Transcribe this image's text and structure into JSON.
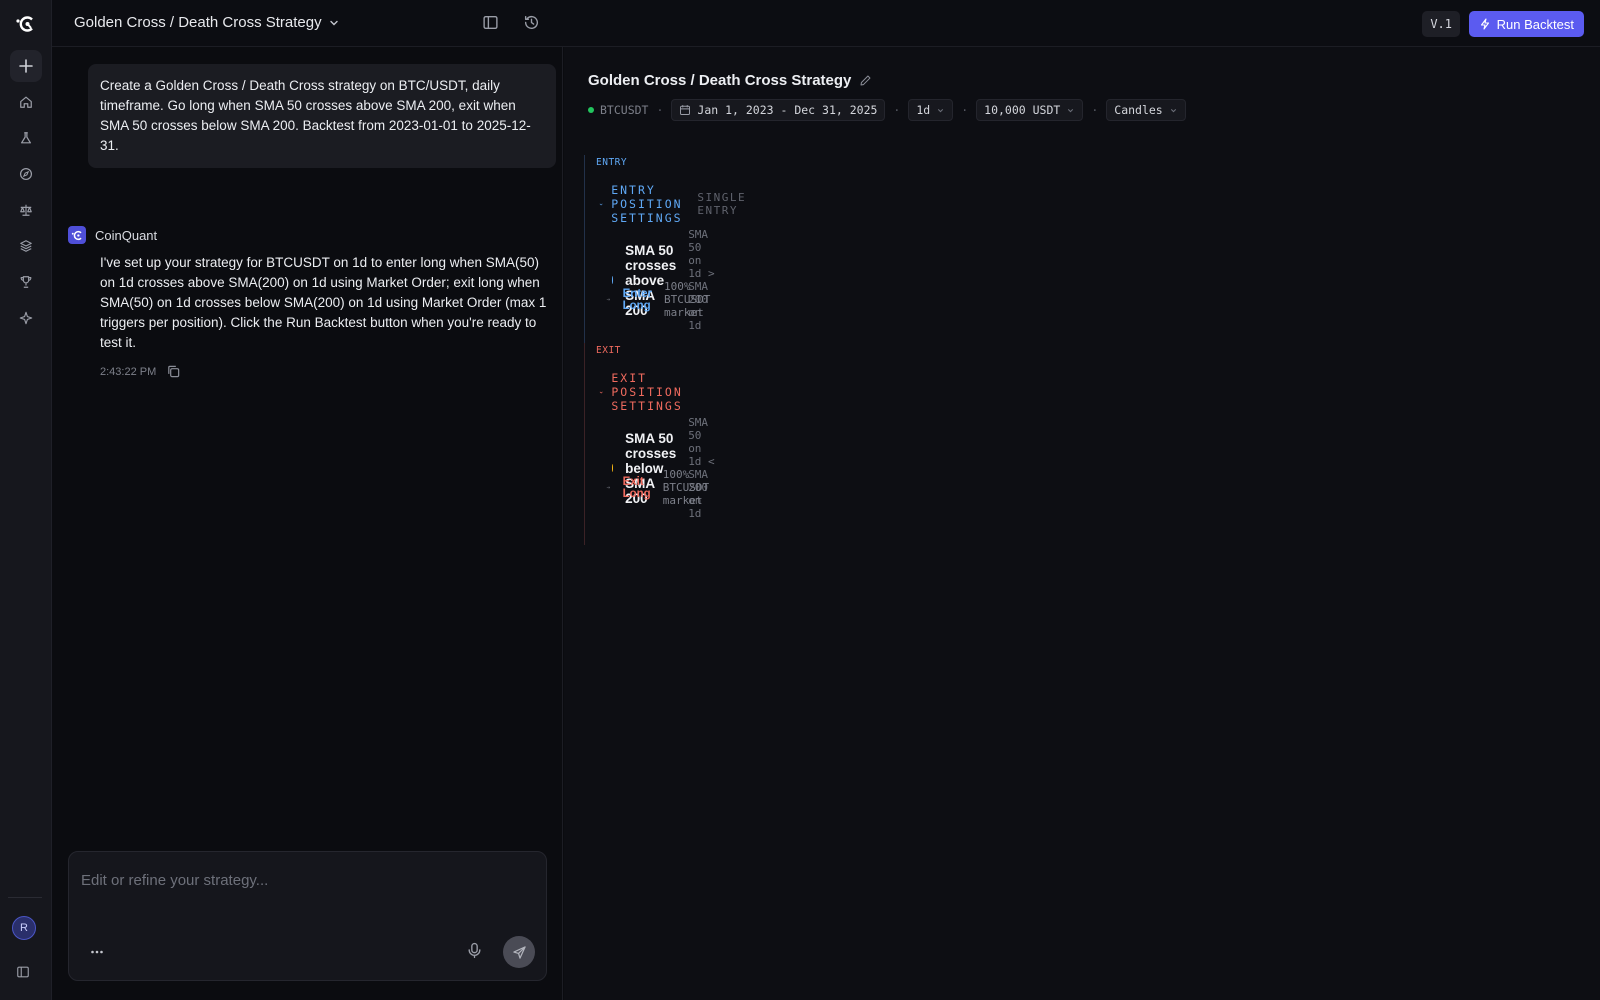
{
  "app": {
    "title": "Golden Cross / Death Cross Strategy",
    "version": "V.1",
    "run_label": "Run Backtest",
    "brand_color": "#5b5bf0"
  },
  "rail": {
    "items": [
      "home-icon",
      "flask-icon",
      "compass-icon",
      "scale-icon",
      "layers-icon",
      "trophy-icon",
      "sparkle-icon"
    ],
    "avatar_initial": "R"
  },
  "chat": {
    "user_message": "Create a Golden Cross / Death Cross strategy on BTC/USDT, daily timeframe. Go long when SMA 50 crosses above SMA 200, exit when SMA 50 crosses below SMA 200. Backtest from 2023-01-01 to 2025-12-31.",
    "bot_name": "CoinQuant",
    "bot_message": "I've set up your strategy for BTCUSDT on 1d to enter long when SMA(50) on 1d crosses above SMA(200) on 1d using Market Order; exit long when SMA(50) on 1d crosses below SMA(200) on 1d using Market Order (max 1 triggers per position). Click the Run Backtest button when you're ready to test it.",
    "bot_time": "2:43:22 PM",
    "composer_placeholder": "Edit or refine your strategy...",
    "composer_value": ""
  },
  "strategy": {
    "title": "Golden Cross / Death Cross Strategy",
    "pair": "BTCUSDT",
    "date_range": "Jan 1, 2023 - Dec 31, 2025",
    "timeframe": "1d",
    "capital": "10,000 USDT",
    "data_source": "Candles",
    "entry": {
      "tag": "ENTRY",
      "heading": "ENTRY POSITION SETTINGS",
      "subheading": "SINGLE ENTRY",
      "condition_name": "SMA 50 crosses above SMA 200",
      "condition_expr": "SMA 50 on 1d > SMA 200 on 1d",
      "action_name": "Enter Long",
      "action_desc": "100% BTCUSDT market",
      "color": "#5fa8f5"
    },
    "exit": {
      "tag": "EXIT",
      "heading": "EXIT POSITION SETTINGS",
      "condition_name": "SMA 50 crosses below SMA 200",
      "condition_expr": "SMA 50 on 1d < SMA 200 on 1d",
      "action_name": "Exit Long",
      "action_desc": "100% BTCUSDT market",
      "color": "#ef6a5e"
    }
  }
}
